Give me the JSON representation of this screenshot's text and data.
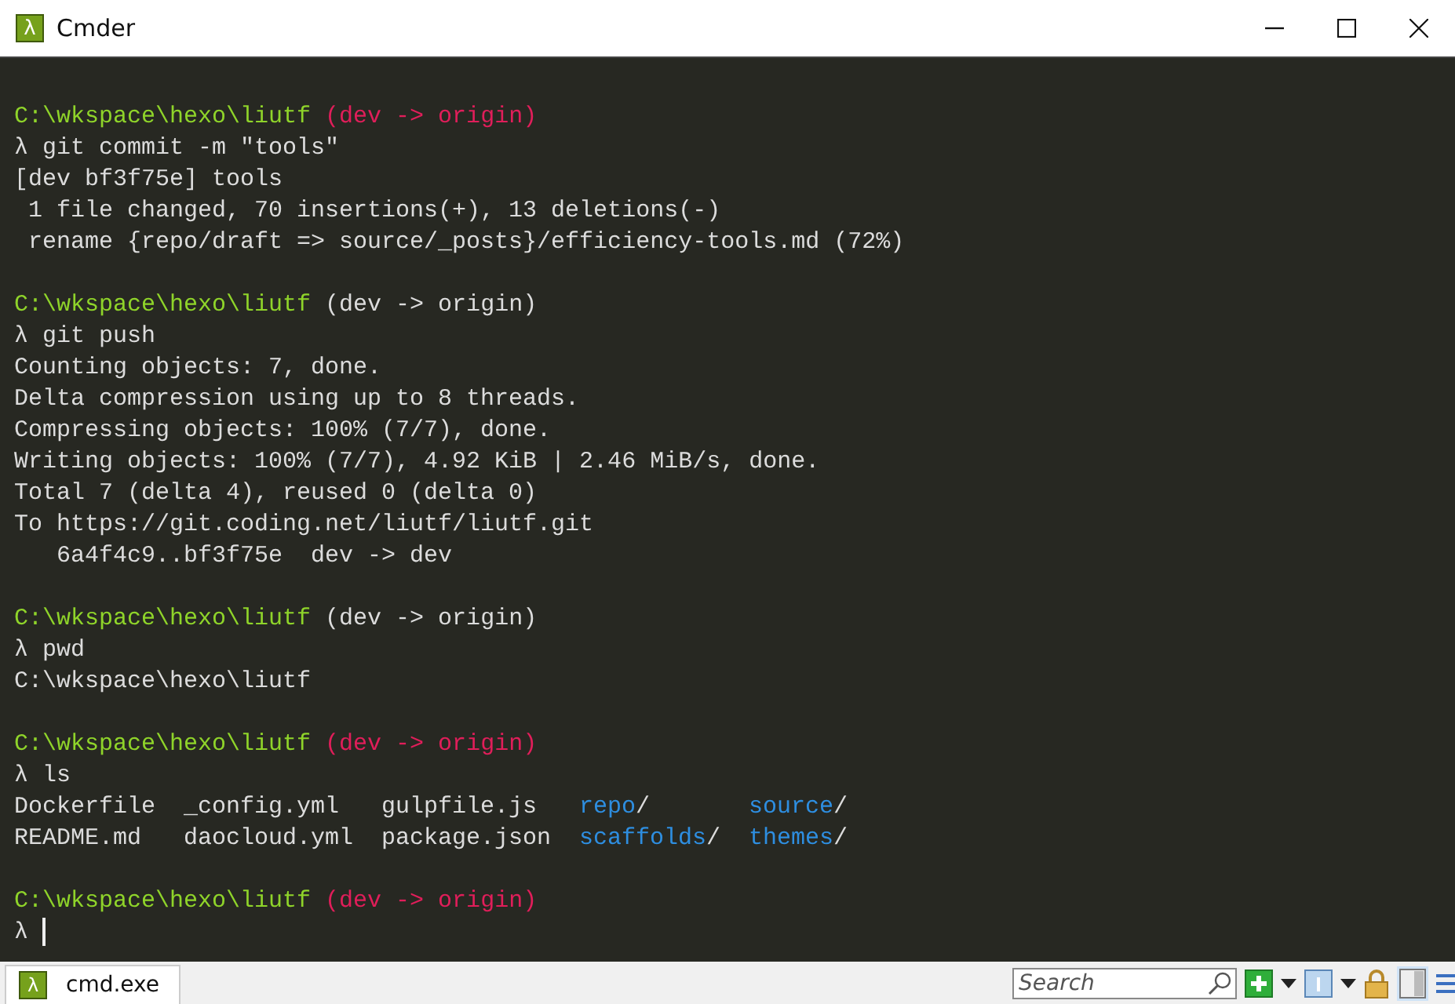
{
  "window": {
    "title": "Cmder",
    "icon_glyph": "λ"
  },
  "terminal": {
    "lines": [
      {
        "kind": "prompt",
        "segments": [
          {
            "kind": "path",
            "text": "C:\\wkspace\\hexo\\liutf"
          },
          {
            "kind": "branch_dirty",
            "text": "(dev -> origin)"
          }
        ]
      },
      {
        "kind": "command",
        "segments": [
          {
            "kind": "plain",
            "text": "λ git commit -m \"tools\""
          }
        ]
      },
      {
        "kind": "output",
        "segments": [
          {
            "kind": "plain",
            "text": "[dev bf3f75e] tools"
          }
        ]
      },
      {
        "kind": "output",
        "segments": [
          {
            "kind": "plain",
            "text": " 1 file changed, 70 insertions(+), 13 deletions(-)"
          }
        ]
      },
      {
        "kind": "output",
        "segments": [
          {
            "kind": "plain",
            "text": " rename {repo/draft => source/_posts}/efficiency-tools.md (72%)"
          }
        ]
      },
      {
        "kind": "blank"
      },
      {
        "kind": "prompt",
        "segments": [
          {
            "kind": "path",
            "text": "C:\\wkspace\\hexo\\liutf"
          },
          {
            "kind": "branch",
            "text": "(dev -> origin)"
          }
        ]
      },
      {
        "kind": "command",
        "segments": [
          {
            "kind": "plain",
            "text": "λ git push"
          }
        ]
      },
      {
        "kind": "output",
        "segments": [
          {
            "kind": "plain",
            "text": "Counting objects: 7, done."
          }
        ]
      },
      {
        "kind": "output",
        "segments": [
          {
            "kind": "plain",
            "text": "Delta compression using up to 8 threads."
          }
        ]
      },
      {
        "kind": "output",
        "segments": [
          {
            "kind": "plain",
            "text": "Compressing objects: 100% (7/7), done."
          }
        ]
      },
      {
        "kind": "output",
        "segments": [
          {
            "kind": "plain",
            "text": "Writing objects: 100% (7/7), 4.92 KiB | 2.46 MiB/s, done."
          }
        ]
      },
      {
        "kind": "output",
        "segments": [
          {
            "kind": "plain",
            "text": "Total 7 (delta 4), reused 0 (delta 0)"
          }
        ]
      },
      {
        "kind": "output",
        "segments": [
          {
            "kind": "plain",
            "text": "To https://git.coding.net/liutf/liutf.git"
          }
        ]
      },
      {
        "kind": "output",
        "segments": [
          {
            "kind": "plain",
            "text": "   6a4f4c9..bf3f75e  dev -> dev"
          }
        ]
      },
      {
        "kind": "blank"
      },
      {
        "kind": "prompt",
        "segments": [
          {
            "kind": "path",
            "text": "C:\\wkspace\\hexo\\liutf"
          },
          {
            "kind": "branch",
            "text": "(dev -> origin)"
          }
        ]
      },
      {
        "kind": "command",
        "segments": [
          {
            "kind": "plain",
            "text": "λ pwd"
          }
        ]
      },
      {
        "kind": "output",
        "segments": [
          {
            "kind": "plain",
            "text": "C:\\wkspace\\hexo\\liutf"
          }
        ]
      },
      {
        "kind": "blank"
      },
      {
        "kind": "prompt",
        "segments": [
          {
            "kind": "path",
            "text": "C:\\wkspace\\hexo\\liutf"
          },
          {
            "kind": "branch_dirty",
            "text": "(dev -> origin)"
          }
        ]
      },
      {
        "kind": "command",
        "segments": [
          {
            "kind": "plain",
            "text": "λ ls"
          }
        ]
      },
      {
        "kind": "listing",
        "entries": [
          {
            "kind": "file",
            "name": "Dockerfile"
          },
          {
            "kind": "file",
            "name": "_config.yml"
          },
          {
            "kind": "file",
            "name": "gulpfile.js"
          },
          {
            "kind": "dir",
            "name": "repo",
            "suffix": "/"
          },
          {
            "kind": "dir",
            "name": "source",
            "suffix": "/"
          }
        ]
      },
      {
        "kind": "listing",
        "entries": [
          {
            "kind": "file",
            "name": "README.md"
          },
          {
            "kind": "file",
            "name": "daocloud.yml"
          },
          {
            "kind": "file",
            "name": "package.json"
          },
          {
            "kind": "dir",
            "name": "scaffolds",
            "suffix": "/"
          },
          {
            "kind": "dir",
            "name": "themes",
            "suffix": "/"
          }
        ]
      },
      {
        "kind": "blank"
      },
      {
        "kind": "prompt",
        "segments": [
          {
            "kind": "path",
            "text": "C:\\wkspace\\hexo\\liutf"
          },
          {
            "kind": "branch_dirty",
            "text": "(dev -> origin)"
          }
        ]
      },
      {
        "kind": "input",
        "segments": [
          {
            "kind": "plain",
            "text": "λ"
          }
        ],
        "cursor": true
      }
    ]
  },
  "status_bar": {
    "tab": {
      "label": "cmd.exe",
      "icon_glyph": "λ",
      "selected": true
    },
    "search": {
      "placeholder": "Search"
    }
  }
}
